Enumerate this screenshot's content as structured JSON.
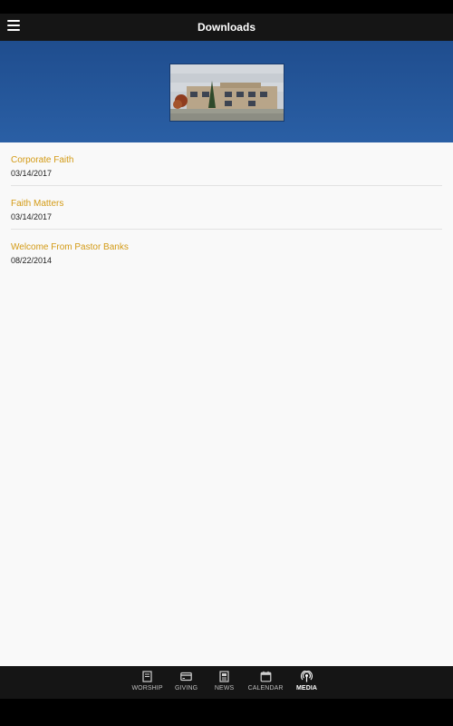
{
  "app": {
    "title": "Downloads"
  },
  "downloads": [
    {
      "title": "Corporate Faith",
      "date": "03/14/2017"
    },
    {
      "title": "Faith Matters",
      "date": "03/14/2017"
    },
    {
      "title": "Welcome From Pastor Banks",
      "date": "08/22/2014"
    }
  ],
  "tabs": [
    {
      "label": "WORSHIP",
      "icon": "book-icon"
    },
    {
      "label": "GIVING",
      "icon": "credit-card-icon"
    },
    {
      "label": "NEWS",
      "icon": "newspaper-icon"
    },
    {
      "label": "CALENDAR",
      "icon": "calendar-icon"
    },
    {
      "label": "MEDIA",
      "icon": "podcast-icon",
      "active": true
    }
  ],
  "colors": {
    "accent": "#d39a15",
    "banner": "#2a5fa5",
    "appbar": "#151515",
    "content_bg": "#f9f9f9"
  }
}
